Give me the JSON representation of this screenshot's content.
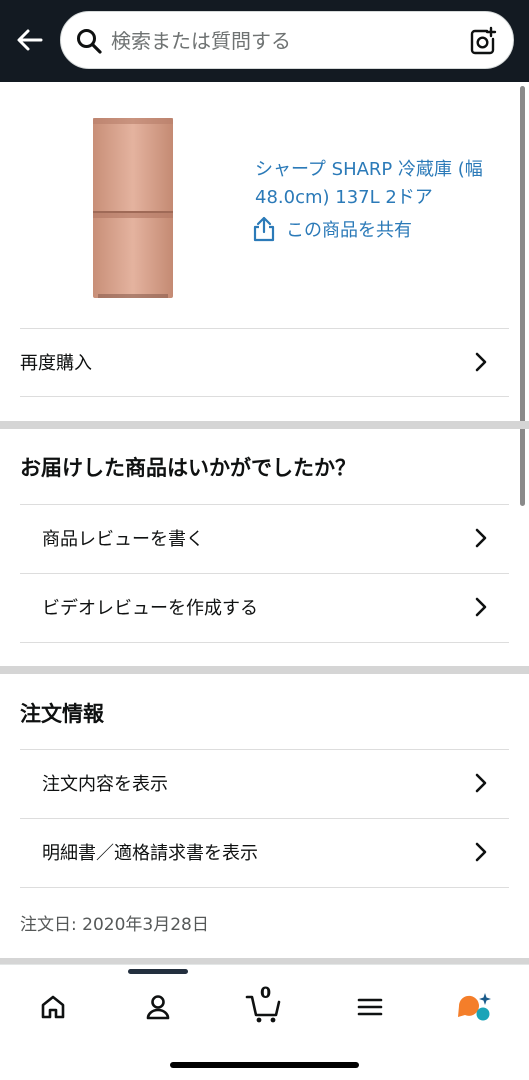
{
  "header": {
    "search_placeholder": "検索または質問する"
  },
  "product": {
    "title": "シャープ SHARP 冷蔵庫 (幅48.0cm) 137L 2ドア",
    "share_label": "この商品を共有"
  },
  "actions": {
    "buy_again": "再度購入"
  },
  "review_section": {
    "title": "お届けした商品はいかがでしたか？",
    "write_review": "商品レビューを書く",
    "create_video_review": "ビデオレビューを作成する"
  },
  "order_section": {
    "title": "注文情報",
    "view_order": "注文内容を表示",
    "view_invoice": "明細書／適格請求書を表示",
    "order_date": "注文日: 2020年3月28日"
  },
  "bottom_nav": {
    "cart_count": "0",
    "items": [
      "home-icon",
      "account-icon",
      "cart-icon",
      "menu-icon",
      "rufus-icon"
    ]
  },
  "colors": {
    "header_bg": "#131a22",
    "link": "#2b7ab8",
    "product_body": "#d9a48f"
  }
}
